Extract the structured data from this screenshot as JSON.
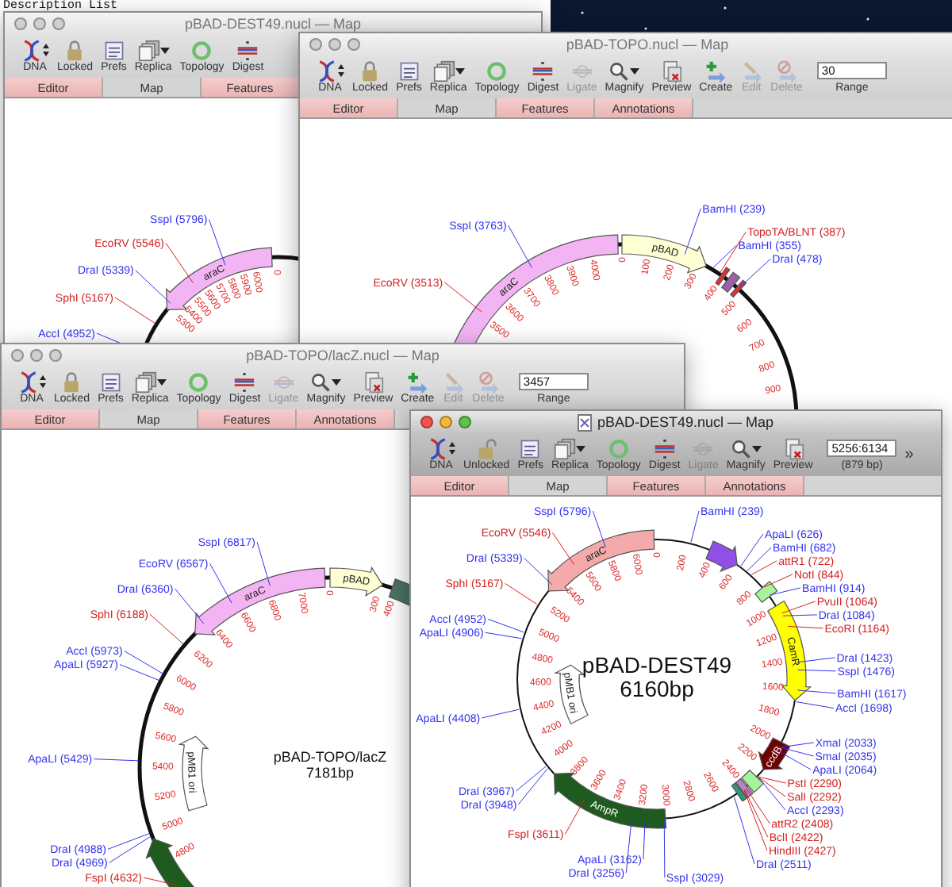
{
  "desktop": {
    "text": "Description List"
  },
  "windows": [
    {
      "title": "pBAD-DEST49.nucl — Map",
      "active": false,
      "doc_icon": false,
      "toolbar": [
        {
          "kind": "dna",
          "label": "DNA",
          "disabled": false
        },
        {
          "kind": "lock",
          "label": "Locked",
          "disabled": false
        },
        {
          "kind": "prefs",
          "label": "Prefs",
          "disabled": false
        },
        {
          "kind": "replica",
          "label": "Replica",
          "disabled": false
        },
        {
          "kind": "topology",
          "label": "Topology",
          "disabled": false
        },
        {
          "kind": "digest",
          "label": "Digest",
          "disabled": false
        }
      ],
      "tabs": [
        {
          "label": "Editor",
          "selected": false
        },
        {
          "label": "Map",
          "selected": true
        },
        {
          "label": "Features",
          "selected": false
        }
      ],
      "map": {
        "features": [
          {
            "label": "araC",
            "color": "#f2b4f2"
          }
        ],
        "sites": [
          {
            "label": "SspI (5796)",
            "color": "#3333ee"
          },
          {
            "label": "EcoRV (5546)",
            "color": "#d42020"
          },
          {
            "label": "DraI (5339)",
            "color": "#3333ee"
          },
          {
            "label": "SphI (5167)",
            "color": "#d42020"
          },
          {
            "label": "AccI (4952)",
            "color": "#3333ee"
          }
        ],
        "ticks": [
          "0",
          "6000",
          "5900",
          "5800",
          "5700",
          "5600",
          "5500",
          "5400",
          "5300"
        ]
      }
    },
    {
      "title": "pBAD-TOPO.nucl — Map",
      "active": false,
      "doc_icon": false,
      "toolbar": [
        {
          "kind": "dna",
          "label": "DNA",
          "disabled": false
        },
        {
          "kind": "lock",
          "label": "Locked",
          "disabled": false
        },
        {
          "kind": "prefs",
          "label": "Prefs",
          "disabled": false
        },
        {
          "kind": "replica",
          "label": "Replica",
          "disabled": false
        },
        {
          "kind": "topology",
          "label": "Topology",
          "disabled": false
        },
        {
          "kind": "digest",
          "label": "Digest",
          "disabled": false
        },
        {
          "kind": "ligate",
          "label": "Ligate",
          "disabled": true
        },
        {
          "kind": "magnify",
          "label": "Magnify",
          "disabled": false
        },
        {
          "kind": "preview",
          "label": "Preview",
          "disabled": false
        },
        {
          "kind": "create",
          "label": "Create",
          "disabled": false
        },
        {
          "kind": "edit",
          "label": "Edit",
          "disabled": true
        },
        {
          "kind": "delete",
          "label": "Delete",
          "disabled": true
        }
      ],
      "range": {
        "value": "30",
        "label": "Range"
      },
      "tabs": [
        {
          "label": "Editor",
          "selected": false
        },
        {
          "label": "Map",
          "selected": true
        },
        {
          "label": "Features",
          "selected": false
        },
        {
          "label": "Annotations",
          "selected": false
        }
      ],
      "map": {
        "features": [
          {
            "label": "araC",
            "color": "#f2b4f2"
          },
          {
            "label": "pBAD",
            "color": "#ffffd4"
          },
          {
            "color": "#e03030"
          },
          {
            "color": "#9a60a8"
          },
          {
            "color": "#e03030"
          }
        ],
        "sites": [
          {
            "label": "BamHI (239)",
            "color": "#3333ee"
          },
          {
            "label": "TopoTA/BLNT (387)",
            "color": "#d42020"
          },
          {
            "label": "BamHI (355)",
            "color": "#3333ee"
          },
          {
            "label": "DraI (478)",
            "color": "#3333ee"
          },
          {
            "label": "SspI (3763)",
            "color": "#3333ee"
          },
          {
            "label": "EcoRV (3513)",
            "color": "#d42020"
          }
        ],
        "ticks": [
          "0",
          "100",
          "200",
          "300",
          "400",
          "500",
          "600",
          "700",
          "800",
          "900",
          "3500",
          "3600",
          "3700",
          "3800",
          "3900",
          "4000"
        ]
      }
    },
    {
      "title": "pBAD-TOPO/lacZ.nucl — Map",
      "active": false,
      "doc_icon": false,
      "toolbar": [
        {
          "kind": "dna",
          "label": "DNA",
          "disabled": false
        },
        {
          "kind": "lock",
          "label": "Locked",
          "disabled": false
        },
        {
          "kind": "prefs",
          "label": "Prefs",
          "disabled": false
        },
        {
          "kind": "replica",
          "label": "Replica",
          "disabled": false
        },
        {
          "kind": "topology",
          "label": "Topology",
          "disabled": false
        },
        {
          "kind": "digest",
          "label": "Digest",
          "disabled": false
        },
        {
          "kind": "ligate",
          "label": "Ligate",
          "disabled": true
        },
        {
          "kind": "magnify",
          "label": "Magnify",
          "disabled": false
        },
        {
          "kind": "preview",
          "label": "Preview",
          "disabled": false
        },
        {
          "kind": "create",
          "label": "Create",
          "disabled": false
        },
        {
          "kind": "edit",
          "label": "Edit",
          "disabled": true
        },
        {
          "kind": "delete",
          "label": "Delete",
          "disabled": true
        }
      ],
      "range": {
        "value": "3457",
        "label": "Range"
      },
      "tabs": [
        {
          "label": "Editor",
          "selected": false
        },
        {
          "label": "Map",
          "selected": true
        },
        {
          "label": "Features",
          "selected": false
        },
        {
          "label": "Annotations",
          "selected": false
        }
      ],
      "map": {
        "name": "pBAD-TOPO/lacZ",
        "length": "7181bp",
        "features": [
          {
            "label": "araC",
            "color": "#f2b4f2"
          },
          {
            "label": "pBAD",
            "color": "#ffffd4"
          },
          {
            "color": "#4a7262"
          },
          {
            "label": "pMB1 ori",
            "color": "#ffffff"
          },
          {
            "color": "#1f5a1f"
          }
        ],
        "sites": [
          {
            "label": "SspI (6817)",
            "color": "#3333ee"
          },
          {
            "label": "EcoRV (6567)",
            "color": "#3333ee"
          },
          {
            "label": "DraI (6360)",
            "color": "#3333ee"
          },
          {
            "label": "SphI (6188)",
            "color": "#d42020"
          },
          {
            "label": "AccI (5973)",
            "color": "#3333ee"
          },
          {
            "label": "ApaLI (5927)",
            "color": "#3333ee"
          },
          {
            "label": "ApaLI (5429)",
            "color": "#3333ee"
          },
          {
            "label": "DraI (4988)",
            "color": "#3333ee"
          },
          {
            "label": "DraI (4969)",
            "color": "#3333ee"
          },
          {
            "label": "FspI (4632)",
            "color": "#d42020"
          }
        ],
        "ticks": [
          "0",
          "300",
          "400",
          "7000",
          "6800",
          "6600",
          "6400",
          "6200",
          "6000",
          "5800",
          "5600",
          "5400",
          "5200",
          "5000",
          "4800"
        ]
      }
    },
    {
      "title": "pBAD-DEST49.nucl — Map",
      "active": true,
      "doc_icon": true,
      "toolbar": [
        {
          "kind": "dna",
          "label": "DNA",
          "disabled": false
        },
        {
          "kind": "unlock",
          "label": "Unlocked",
          "disabled": false
        },
        {
          "kind": "prefs",
          "label": "Prefs",
          "disabled": false
        },
        {
          "kind": "replica",
          "label": "Replica",
          "disabled": false
        },
        {
          "kind": "topology",
          "label": "Topology",
          "disabled": false
        },
        {
          "kind": "digest",
          "label": "Digest",
          "disabled": false
        },
        {
          "kind": "ligate",
          "label": "Ligate",
          "disabled": true
        },
        {
          "kind": "magnify",
          "label": "Magnify",
          "disabled": false
        },
        {
          "kind": "preview",
          "label": "Preview",
          "disabled": false
        }
      ],
      "range": {
        "value": "5256:6134",
        "label": "(879 bp)"
      },
      "overflow": "»",
      "tabs": [
        {
          "label": "Editor",
          "selected": false
        },
        {
          "label": "Map",
          "selected": true
        },
        {
          "label": "Features",
          "selected": false
        },
        {
          "label": "Annotations",
          "selected": false
        }
      ],
      "map": {
        "name": "pBAD-DEST49",
        "length": "6160bp",
        "features": [
          {
            "label": "araC",
            "color": "#f4aaaa"
          },
          {
            "color": "#9050e6"
          },
          {
            "color": "#a8f29a"
          },
          {
            "label": "CamR",
            "color": "#ffff00"
          },
          {
            "label": "ccdB",
            "color": "#6e0000"
          },
          {
            "color": "#a8f29a"
          },
          {
            "color": "#c080c8"
          },
          {
            "color": "#2a9a7a"
          },
          {
            "label": "AmpR",
            "color": "#1f5a1f"
          },
          {
            "label": "pMB1 ori",
            "color": "#ffffff"
          }
        ],
        "sites": [
          {
            "label": "SspI (5796)",
            "color": "#3333ee"
          },
          {
            "label": "EcoRV (5546)",
            "color": "#d42020"
          },
          {
            "label": "DraI (5339)",
            "color": "#3333ee"
          },
          {
            "label": "SphI (5167)",
            "color": "#d42020"
          },
          {
            "label": "AccI (4952)",
            "color": "#3333ee"
          },
          {
            "label": "ApaLI (4906)",
            "color": "#3333ee"
          },
          {
            "label": "ApaLI (4408)",
            "color": "#3333ee"
          },
          {
            "label": "DraI (3967)",
            "color": "#3333ee"
          },
          {
            "label": "DraI (3948)",
            "color": "#3333ee"
          },
          {
            "label": "FspI (3611)",
            "color": "#d42020"
          },
          {
            "label": "ApaLI (3162)",
            "color": "#3333ee"
          },
          {
            "label": "DraI (3256)",
            "color": "#3333ee"
          },
          {
            "label": "BamHI (239)",
            "color": "#3333ee"
          },
          {
            "label": "ApaLI (626)",
            "color": "#3333ee"
          },
          {
            "label": "BamHI (682)",
            "color": "#3333ee"
          },
          {
            "label": "attR1 (722)",
            "color": "#d42020"
          },
          {
            "label": "NotI (844)",
            "color": "#d42020"
          },
          {
            "label": "BamHI (914)",
            "color": "#3333ee"
          },
          {
            "label": "PvuII (1064)",
            "color": "#d42020"
          },
          {
            "label": "DraI (1084)",
            "color": "#3333ee"
          },
          {
            "label": "EcoRI (1164)",
            "color": "#d42020"
          },
          {
            "label": "DraI (1423)",
            "color": "#3333ee"
          },
          {
            "label": "SspI (1476)",
            "color": "#3333ee"
          },
          {
            "label": "BamHI (1617)",
            "color": "#3333ee"
          },
          {
            "label": "AccI (1698)",
            "color": "#3333ee"
          },
          {
            "label": "XmaI (2033)",
            "color": "#3333ee"
          },
          {
            "label": "SmaI (2035)",
            "color": "#3333ee"
          },
          {
            "label": "ApaLI (2064)",
            "color": "#3333ee"
          },
          {
            "label": "PstI (2290)",
            "color": "#d42020"
          },
          {
            "label": "SalI (2292)",
            "color": "#d42020"
          },
          {
            "label": "AccI (2293)",
            "color": "#3333ee"
          },
          {
            "label": "attR2 (2408)",
            "color": "#d42020"
          },
          {
            "label": "BclI (2422)",
            "color": "#d42020"
          },
          {
            "label": "HindIII (2427)",
            "color": "#d42020"
          },
          {
            "label": "DraI (2511)",
            "color": "#3333ee"
          },
          {
            "label": "SspI (3029)",
            "color": "#3333ee"
          }
        ],
        "ticks": [
          "0",
          "200",
          "400",
          "600",
          "800",
          "1000",
          "1200",
          "1400",
          "1600",
          "1800",
          "2000",
          "2200",
          "2400",
          "2600",
          "2800",
          "3000",
          "3200",
          "3400",
          "3600",
          "3800",
          "4000",
          "4200",
          "4400",
          "4600",
          "4800",
          "5000",
          "5200",
          "5400",
          "5600",
          "5800",
          "6000"
        ]
      }
    }
  ]
}
